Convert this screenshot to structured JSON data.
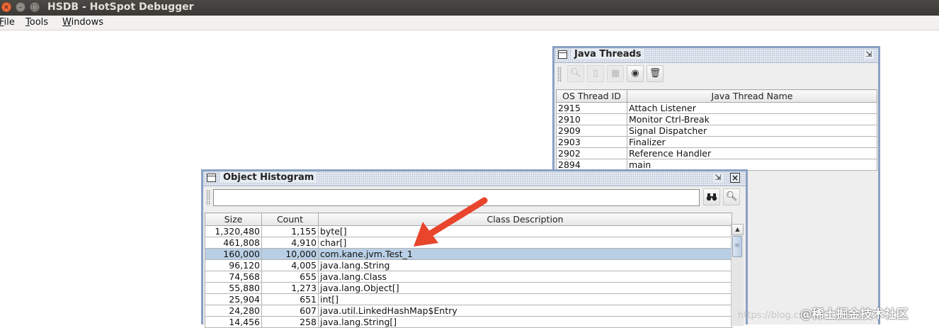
{
  "app": {
    "title": "HSDB - HotSpot Debugger",
    "window_buttons": {
      "close": "×",
      "minimize": "–",
      "maximize": "□"
    }
  },
  "menu": {
    "items": [
      {
        "mnemonic": "F",
        "rest": "ile"
      },
      {
        "mnemonic": "T",
        "rest": "ools"
      },
      {
        "mnemonic": "W",
        "rest": "indows"
      }
    ]
  },
  "threads_window": {
    "title": "Java Threads",
    "toolbar_icons": [
      "inspect-icon",
      "stack-icon",
      "info-icon",
      "find-crashes-icon",
      "delete-icon"
    ],
    "columns": [
      "OS Thread ID",
      "Java Thread Name"
    ],
    "rows": [
      {
        "id": "2915",
        "name": "Attach Listener"
      },
      {
        "id": "2910",
        "name": "Monitor Ctrl-Break"
      },
      {
        "id": "2909",
        "name": "Signal Dispatcher"
      },
      {
        "id": "2903",
        "name": "Finalizer"
      },
      {
        "id": "2902",
        "name": "Reference Handler"
      },
      {
        "id": "2894",
        "name": "main"
      }
    ]
  },
  "histogram_window": {
    "title": "Object Histogram",
    "search": {
      "value": "",
      "placeholder": ""
    },
    "columns": [
      "Size",
      "Count",
      "Class Description"
    ],
    "selected_row": 2,
    "rows": [
      {
        "size": "1,320,480",
        "count": "1,155",
        "desc": "byte[]"
      },
      {
        "size": "461,808",
        "count": "4,910",
        "desc": "char[]"
      },
      {
        "size": "160,000",
        "count": "10,000",
        "desc": "com.kane.jvm.Test_1"
      },
      {
        "size": "96,120",
        "count": "4,005",
        "desc": "java.lang.String"
      },
      {
        "size": "74,568",
        "count": "655",
        "desc": "java.lang.Class"
      },
      {
        "size": "55,880",
        "count": "1,273",
        "desc": "java.lang.Object[]"
      },
      {
        "size": "25,904",
        "count": "651",
        "desc": "int[]"
      },
      {
        "size": "24,280",
        "count": "607",
        "desc": "java.util.LinkedHashMap$Entry"
      },
      {
        "size": "14,456",
        "count": "258",
        "desc": "java.lang.String[]"
      }
    ]
  },
  "annotation": {
    "arrow_color": "#e8452c"
  },
  "watermark": {
    "small": "https://blog.csdn.n",
    "big": "@稀土掘金技术社区"
  }
}
